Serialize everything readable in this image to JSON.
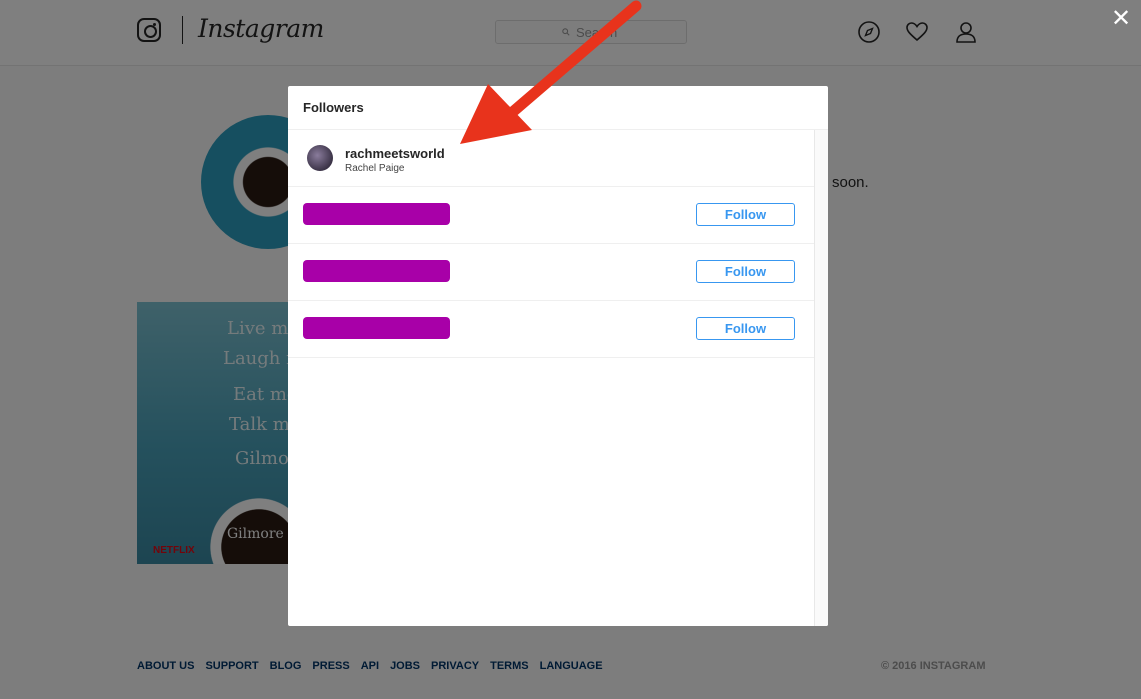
{
  "app": {
    "logo_text": "Instagram",
    "search_placeholder": "Search",
    "nav_icons": [
      "compass-icon",
      "heart-icon",
      "user-icon"
    ]
  },
  "profile_background": {
    "snippet_text": "soon.",
    "post_lines": [
      "Live mo",
      "Laugh m",
      "Eat mor",
      "Talk mo",
      "Gilmor"
    ],
    "post_brand": "NETFLIX",
    "post_caption": "Gilmore gi"
  },
  "modal": {
    "title": "Followers",
    "close_icon": "close-icon",
    "followers": [
      {
        "username": "rachmeetsworld",
        "full_name": "Rachel Paige",
        "redacted": false,
        "button": ""
      },
      {
        "username": "",
        "full_name": "",
        "redacted": true,
        "button": "Follow"
      },
      {
        "username": "",
        "full_name": "",
        "redacted": true,
        "button": "Follow"
      },
      {
        "username": "",
        "full_name": "",
        "redacted": true,
        "button": "Follow"
      }
    ]
  },
  "footer": {
    "links": [
      "ABOUT US",
      "SUPPORT",
      "BLOG",
      "PRESS",
      "API",
      "JOBS",
      "PRIVACY",
      "TERMS",
      "LANGUAGE"
    ],
    "copyright": "© 2016 INSTAGRAM"
  },
  "colors": {
    "accent": "#3897f0",
    "redaction": "#a800a8",
    "annotation_arrow": "#e8331c"
  }
}
